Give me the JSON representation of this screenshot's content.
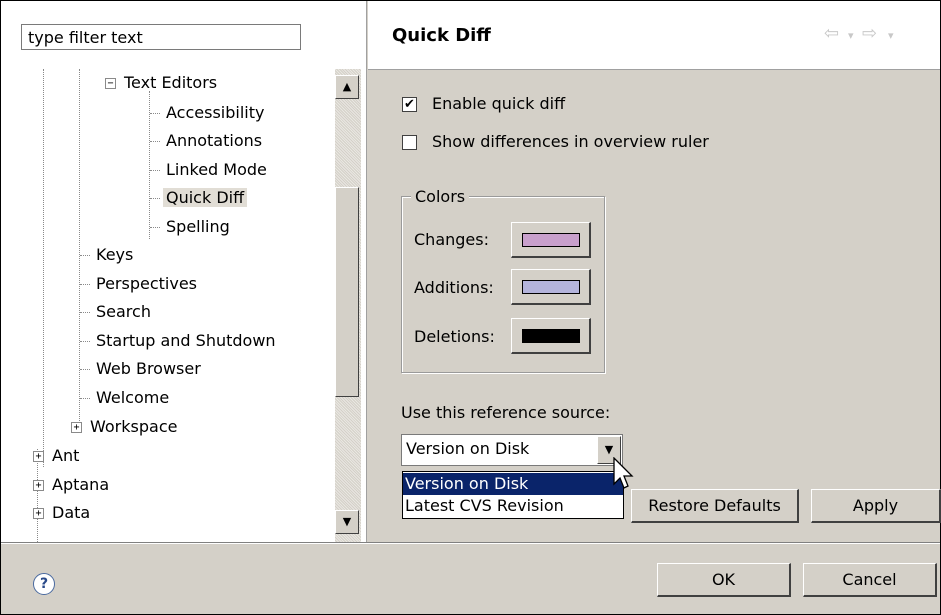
{
  "filter": {
    "placeholder": "type filter text"
  },
  "tree": {
    "items": [
      {
        "label": "Text Editors",
        "level": 2,
        "expander": "−"
      },
      {
        "label": "Accessibility",
        "level": 3
      },
      {
        "label": "Annotations",
        "level": 3
      },
      {
        "label": "Linked Mode",
        "level": 3
      },
      {
        "label": "Quick Diff",
        "level": 3,
        "selected": true
      },
      {
        "label": "Spelling",
        "level": 3
      },
      {
        "label": "Keys",
        "level": 2
      },
      {
        "label": "Perspectives",
        "level": 2
      },
      {
        "label": "Search",
        "level": 2
      },
      {
        "label": "Startup and Shutdown",
        "level": 2
      },
      {
        "label": "Web Browser",
        "level": 2
      },
      {
        "label": "Welcome",
        "level": 2
      },
      {
        "label": "Workspace",
        "level": 2,
        "expander": "+"
      },
      {
        "label": "Ant",
        "level": 1,
        "expander": "+"
      },
      {
        "label": "Aptana",
        "level": 1,
        "expander": "+"
      },
      {
        "label": "Data",
        "level": 1,
        "expander": "+"
      }
    ]
  },
  "header": {
    "title": "Quick Diff"
  },
  "options": {
    "enable_quick_diff": {
      "label": "Enable quick diff",
      "checked": true
    },
    "show_differences": {
      "label": "Show differences in overview ruler",
      "checked": false
    }
  },
  "colors": {
    "legend": "Colors",
    "changes": {
      "label": "Changes:",
      "color": "#c8a0cc"
    },
    "additions": {
      "label": "Additions:",
      "color": "#b4b4dc"
    },
    "deletions": {
      "label": "Deletions:",
      "color": "#000000"
    }
  },
  "reference": {
    "label": "Use this reference source:",
    "value": "Version on Disk",
    "options": [
      "Version on Disk",
      "Latest CVS Revision"
    ]
  },
  "buttons": {
    "restore_defaults": "Restore Defaults",
    "apply": "Apply",
    "ok": "OK",
    "cancel": "Cancel"
  },
  "icons": {
    "help": "help-icon"
  }
}
